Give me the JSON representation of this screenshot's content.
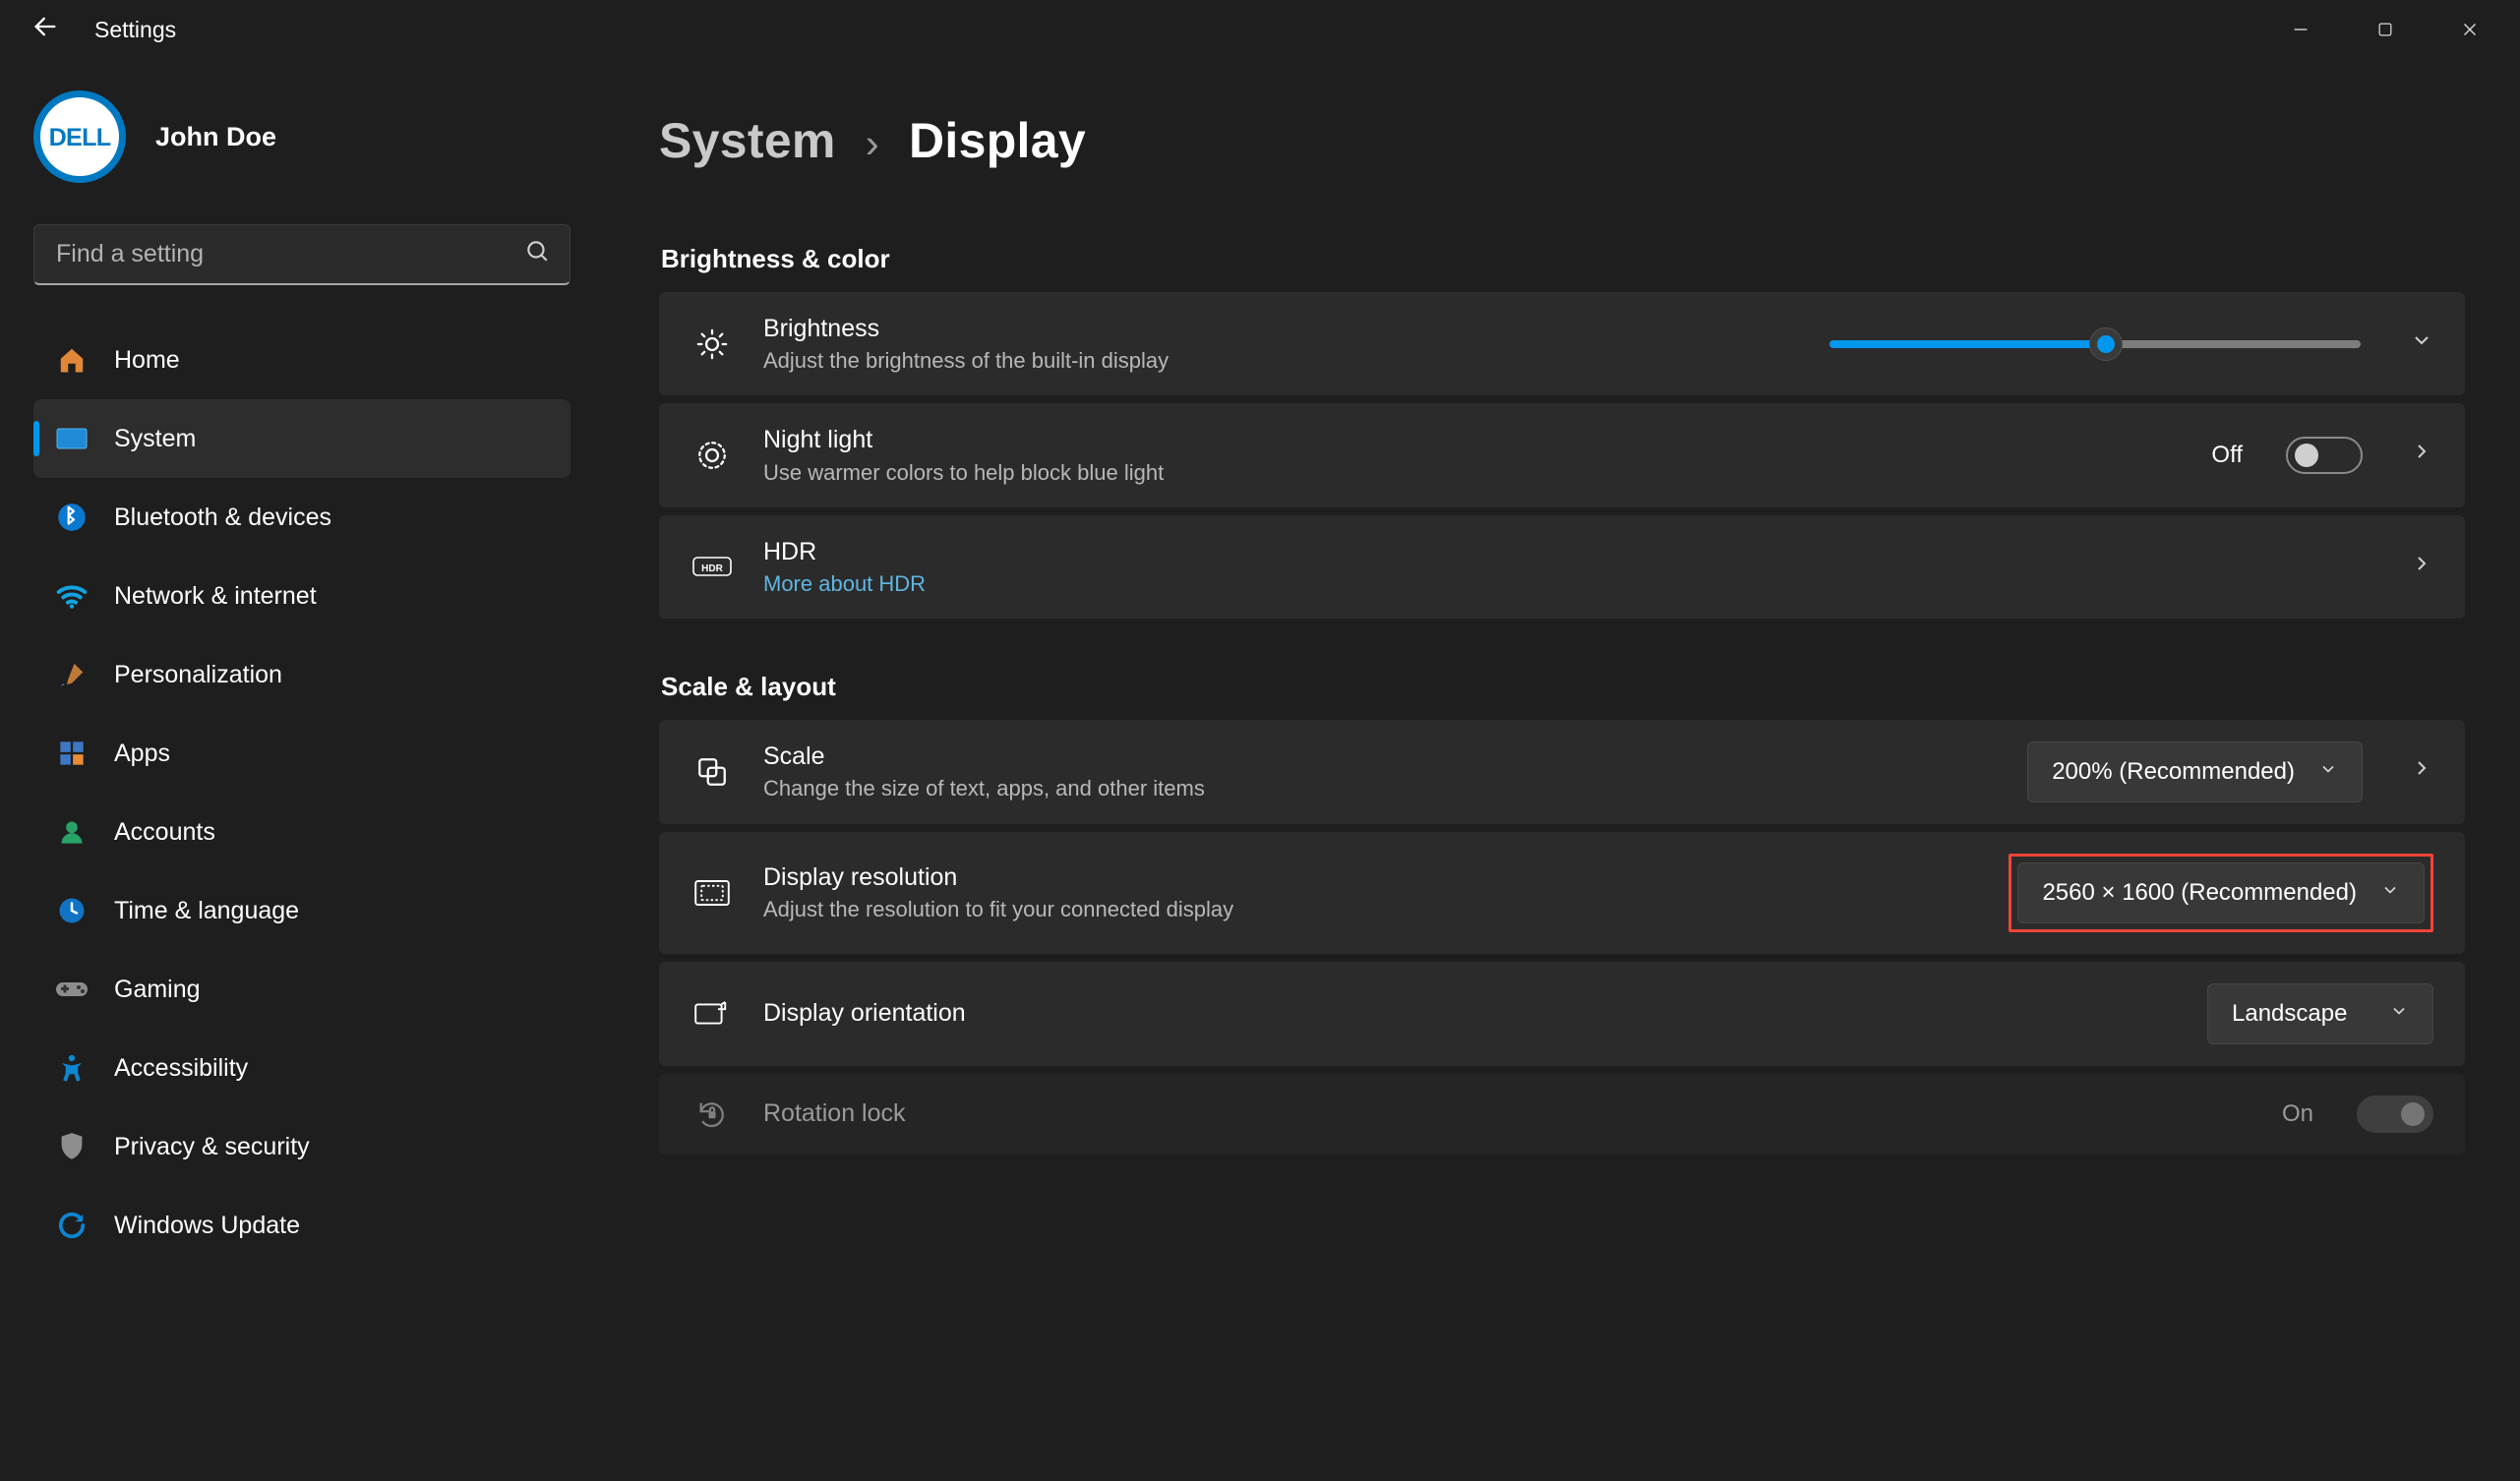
{
  "app_title": "Settings",
  "user_name": "John Doe",
  "search_placeholder": "Find a setting",
  "sidebar": {
    "items": [
      {
        "label": "Home"
      },
      {
        "label": "System"
      },
      {
        "label": "Bluetooth & devices"
      },
      {
        "label": "Network & internet"
      },
      {
        "label": "Personalization"
      },
      {
        "label": "Apps"
      },
      {
        "label": "Accounts"
      },
      {
        "label": "Time & language"
      },
      {
        "label": "Gaming"
      },
      {
        "label": "Accessibility"
      },
      {
        "label": "Privacy & security"
      },
      {
        "label": "Windows Update"
      }
    ],
    "active_index": 1
  },
  "breadcrumb": {
    "parent": "System",
    "current": "Display"
  },
  "sections": {
    "s1": {
      "title": "Brightness & color",
      "brightness": {
        "title": "Brightness",
        "subtitle": "Adjust the brightness of the built-in display",
        "value_percent": 52
      },
      "nightlight": {
        "title": "Night light",
        "subtitle": "Use warmer colors to help block blue light",
        "state_label": "Off",
        "on": false
      },
      "hdr": {
        "title": "HDR",
        "link_text": "More about HDR"
      }
    },
    "s2": {
      "title": "Scale & layout",
      "scale": {
        "title": "Scale",
        "subtitle": "Change the size of text, apps, and other items",
        "value": "200% (Recommended)"
      },
      "resolution": {
        "title": "Display resolution",
        "subtitle": "Adjust the resolution to fit your connected display",
        "value": "2560 × 1600 (Recommended)"
      },
      "orientation": {
        "title": "Display orientation",
        "value": "Landscape"
      },
      "rotation": {
        "title": "Rotation lock",
        "state_label": "On",
        "on": true
      }
    }
  }
}
